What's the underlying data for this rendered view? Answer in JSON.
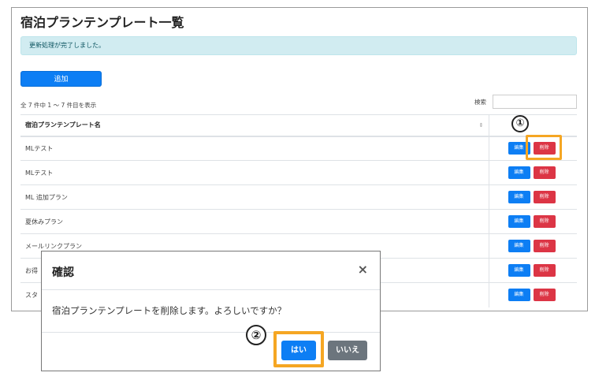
{
  "page": {
    "title": "宿泊プランテンプレート一覧",
    "alert": "更新処理が完了しました。",
    "add_label": "追加",
    "info": "全 7 件中 1 〜 7 件目を表示",
    "search_label": "検索"
  },
  "table": {
    "header_name": "宿泊プランテンプレート名",
    "edit_label": "編集",
    "delete_label": "削除",
    "rows": [
      {
        "name": "MLテスト"
      },
      {
        "name": "MLテスト"
      },
      {
        "name": "ML 追加プラン"
      },
      {
        "name": "夏休みプラン"
      },
      {
        "name": "メールリンクプラン"
      },
      {
        "name": "お得"
      },
      {
        "name": "スタ"
      }
    ]
  },
  "annotations": {
    "marker1": "①",
    "marker2": "②",
    "highlight_color": "#f5a623"
  },
  "modal": {
    "title": "確認",
    "close": "×",
    "message": "宿泊プランテンプレートを削除します。よろしいですか？",
    "yes_label": "はい",
    "no_label": "いいえ"
  },
  "colors": {
    "primary": "#0d7ef4",
    "danger": "#dc3545",
    "secondary": "#6c757d",
    "alert_bg": "#d1ecf1"
  }
}
